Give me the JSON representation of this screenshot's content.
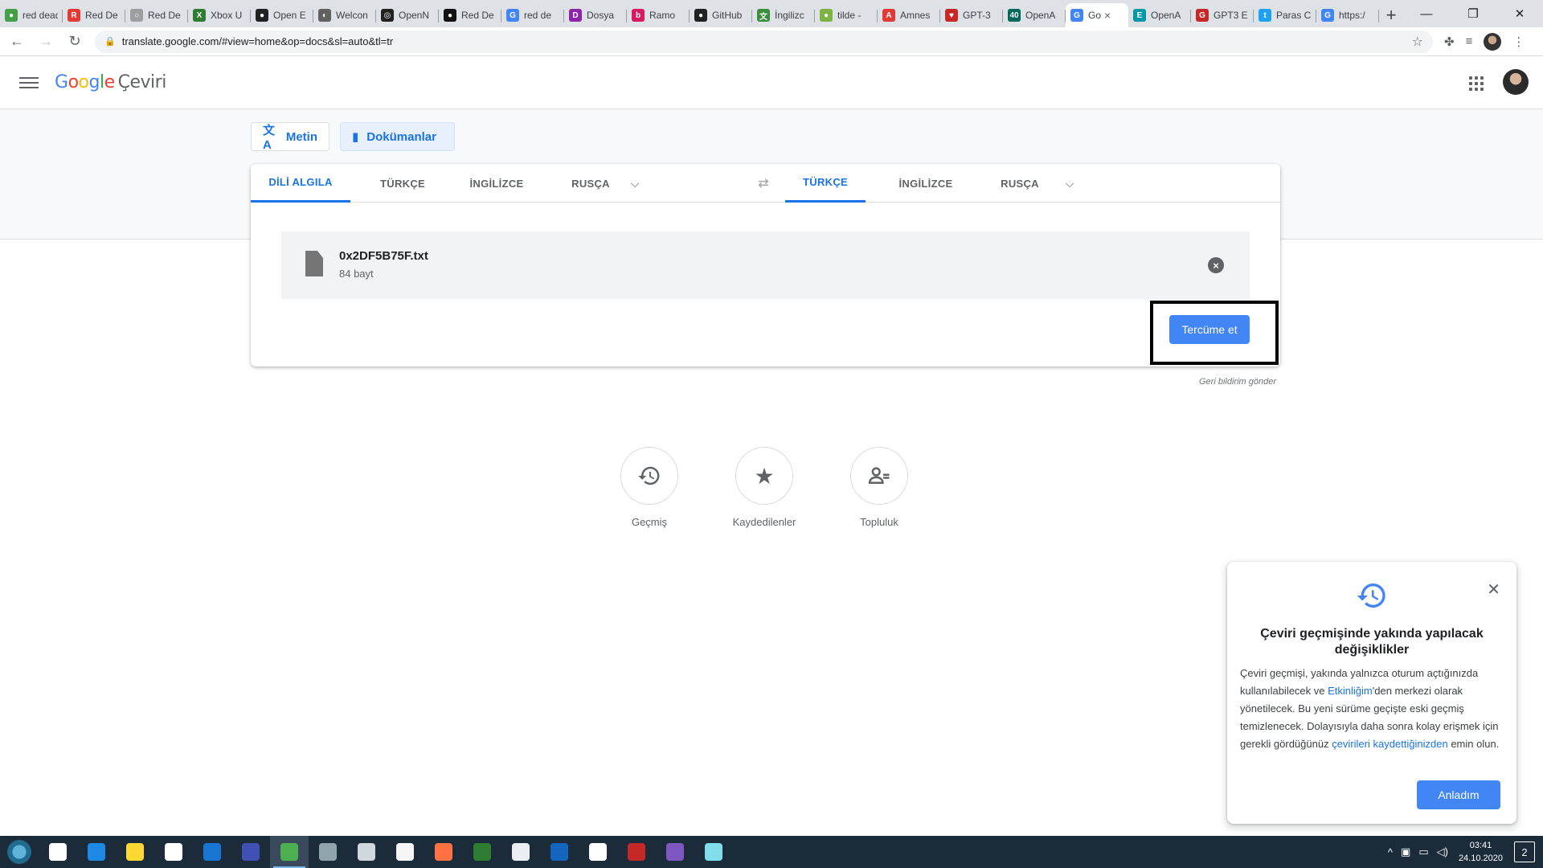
{
  "browser": {
    "tabs": [
      {
        "title": "red dead",
        "color": "#43a047",
        "glyph": "●"
      },
      {
        "title": "Red De",
        "color": "#e53935",
        "glyph": "R"
      },
      {
        "title": "Red De",
        "color": "#9e9e9e",
        "glyph": "○"
      },
      {
        "title": "Xbox U",
        "color": "#2e7d32",
        "glyph": "X"
      },
      {
        "title": "Open E",
        "color": "#212121",
        "glyph": "●"
      },
      {
        "title": "Welcon",
        "color": "#616161",
        "glyph": "◐"
      },
      {
        "title": "OpenN",
        "color": "#212121",
        "glyph": "◎"
      },
      {
        "title": "Red De",
        "color": "#111111",
        "glyph": "●"
      },
      {
        "title": "red de",
        "color": "#4285f4",
        "glyph": "G"
      },
      {
        "title": "Dosya",
        "color": "#8e24aa",
        "glyph": "D"
      },
      {
        "title": "Ramo",
        "color": "#d81b60",
        "glyph": "b"
      },
      {
        "title": "GitHub",
        "color": "#212121",
        "glyph": "●"
      },
      {
        "title": "İngilizc",
        "color": "#388e3c",
        "glyph": "文"
      },
      {
        "title": "tilde -",
        "color": "#7cb342",
        "glyph": "●"
      },
      {
        "title": "Amnes",
        "color": "#e53935",
        "glyph": "A"
      },
      {
        "title": "GPT-3",
        "color": "#c62828",
        "glyph": "♥"
      },
      {
        "title": "OpenA",
        "color": "#00695c",
        "glyph": "40"
      },
      {
        "title": "Go",
        "color": "#4285f4",
        "glyph": "G",
        "active": true
      },
      {
        "title": "OpenA",
        "color": "#0097a7",
        "glyph": "E"
      },
      {
        "title": "GPT3 E",
        "color": "#c62828",
        "glyph": "G"
      },
      {
        "title": "Paras C",
        "color": "#1da1f2",
        "glyph": "t"
      },
      {
        "title": "https:/",
        "color": "#4285f4",
        "glyph": "G"
      }
    ],
    "new_tab": "+",
    "window_controls": {
      "minimize": "—",
      "maximize": "❐",
      "close": "✕"
    },
    "nav": {
      "back": "←",
      "forward": "→",
      "reload": "↻"
    },
    "url": "translate.google.com/#view=home&op=docs&sl=auto&tl=tr",
    "icons": {
      "lock": "lock-icon",
      "star": "star-icon",
      "extensions": "puzzle-icon",
      "media": "media-icon",
      "menu": "kebab-icon"
    }
  },
  "app": {
    "logo": {
      "g1": "G",
      "g2": "o",
      "g3": "o",
      "g4": "g",
      "g5": "l",
      "g6": "e",
      "product": "Çeviri"
    },
    "modes": {
      "text": "Metin",
      "documents": "Dokümanlar"
    },
    "source_langs": {
      "detect": "DİLİ ALGILA",
      "l1": "TÜRKÇE",
      "l2": "İNGİLİZCE",
      "l3": "RUSÇA"
    },
    "target_langs": {
      "l1": "TÜRKÇE",
      "l2": "İNGİLİZCE",
      "l3": "RUSÇA"
    },
    "file": {
      "name": "0x2DF5B75F.txt",
      "size": "84 bayt"
    },
    "translate_button": "Tercüme et",
    "feedback": "Geri bildirim gönder",
    "bottom": {
      "history": "Geçmiş",
      "saved": "Kaydedilenler",
      "community": "Topluluk"
    }
  },
  "popup": {
    "title": "Çeviri geçmişinde yakında yapılacak değişiklikler",
    "body_1": "Çeviri geçmişi, yakında yalnızca oturum açtığınızda kullanılabilecek ve ",
    "link_1": "Etkinliğim",
    "body_2": "'den merkezi olarak yönetilecek. Bu yeni sürüme geçişte eski geçmiş temizlenecek. Dolayısıyla daha sonra kolay erişmek için gerekli gördüğünüz ",
    "link_2": "çevirileri kaydettiğinizden",
    "body_3": " emin olun.",
    "ok_button": "Anladım"
  },
  "taskbar": {
    "apps": [
      {
        "name": "task-view",
        "color": "#ffffff"
      },
      {
        "name": "edge",
        "color": "#1e88e5"
      },
      {
        "name": "file-explorer",
        "color": "#fdd835"
      },
      {
        "name": "store",
        "color": "#ffffff"
      },
      {
        "name": "mail",
        "color": "#1976d2"
      },
      {
        "name": "app-1",
        "color": "#3f51b5"
      },
      {
        "name": "chrome",
        "color": "#4caf50",
        "active": true
      },
      {
        "name": "app-2",
        "color": "#90a4ae"
      },
      {
        "name": "app-3",
        "color": "#cfd8dc"
      },
      {
        "name": "app-4",
        "color": "#f5f5f5"
      },
      {
        "name": "firefox",
        "color": "#ff7043"
      },
      {
        "name": "excel",
        "color": "#2e7d32"
      },
      {
        "name": "app-5",
        "color": "#eceff1"
      },
      {
        "name": "teamviewer",
        "color": "#1565c0"
      },
      {
        "name": "settings",
        "color": "#ffffff"
      },
      {
        "name": "winrar",
        "color": "#c62828"
      },
      {
        "name": "app-6",
        "color": "#7e57c2"
      },
      {
        "name": "app-7",
        "color": "#80deea"
      }
    ],
    "time": "03:41",
    "date": "24.10.2020",
    "notifications": "2"
  }
}
